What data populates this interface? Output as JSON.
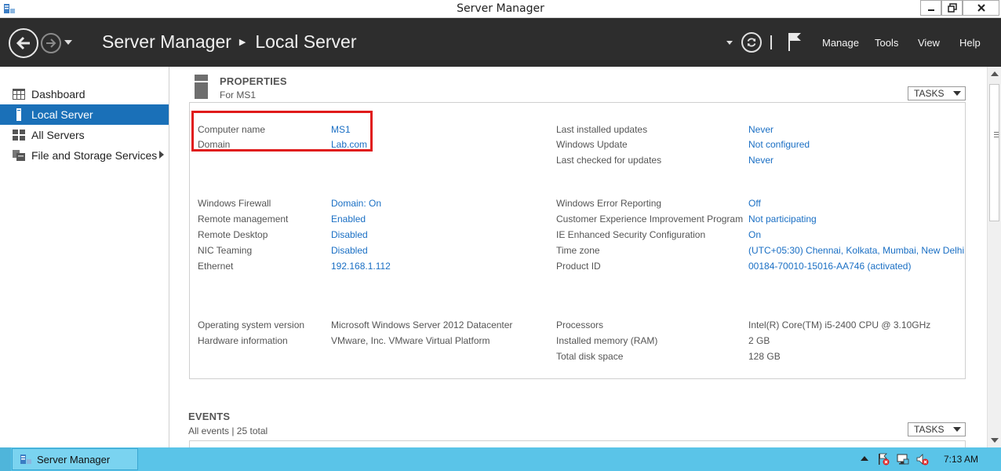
{
  "window": {
    "title": "Server Manager"
  },
  "header": {
    "breadcrumb_root": "Server Manager",
    "breadcrumb_current": "Local Server",
    "menu": [
      "Manage",
      "Tools",
      "View",
      "Help"
    ]
  },
  "sidebar": {
    "items": [
      {
        "label": "Dashboard",
        "icon": "dashboard-grid-icon"
      },
      {
        "label": "Local Server",
        "icon": "server-icon",
        "active": true
      },
      {
        "label": "All Servers",
        "icon": "servers-grid-icon"
      },
      {
        "label": "File and Storage Services",
        "icon": "storage-icon",
        "has_submenu": true
      }
    ]
  },
  "properties": {
    "title": "PROPERTIES",
    "subtitle": "For MS1",
    "tasks_label": "TASKS",
    "left": [
      {
        "label": "Computer name",
        "value": "MS1",
        "link": true
      },
      {
        "label": "Domain",
        "value": "Lab.com",
        "link": true
      },
      {
        "label": "Windows Firewall",
        "value": "Domain: On",
        "link": true
      },
      {
        "label": "Remote management",
        "value": "Enabled",
        "link": true
      },
      {
        "label": "Remote Desktop",
        "value": "Disabled",
        "link": true
      },
      {
        "label": "NIC Teaming",
        "value": "Disabled",
        "link": true
      },
      {
        "label": "Ethernet",
        "value": "192.168.1.112",
        "link": true
      },
      {
        "label": "Operating system version",
        "value": "Microsoft Windows Server 2012 Datacenter",
        "link": false
      },
      {
        "label": "Hardware information",
        "value": "VMware, Inc. VMware Virtual Platform",
        "link": false
      }
    ],
    "right": [
      {
        "label": "Last installed updates",
        "value": "Never",
        "link": true
      },
      {
        "label": "Windows Update",
        "value": "Not configured",
        "link": true
      },
      {
        "label": "Last checked for updates",
        "value": "Never",
        "link": true
      },
      {
        "label": "Windows Error Reporting",
        "value": "Off",
        "link": true
      },
      {
        "label": "Customer Experience Improvement Program",
        "value": "Not participating",
        "link": true
      },
      {
        "label": "IE Enhanced Security Configuration",
        "value": "On",
        "link": true
      },
      {
        "label": "Time zone",
        "value": "(UTC+05:30) Chennai, Kolkata, Mumbai, New Delhi",
        "link": true
      },
      {
        "label": "Product ID",
        "value": "00184-70010-15016-AA746 (activated)",
        "link": true
      },
      {
        "label": "Processors",
        "value": "Intel(R) Core(TM) i5-2400 CPU @ 3.10GHz",
        "link": false
      },
      {
        "label": "Installed memory (RAM)",
        "value": "2 GB",
        "link": false
      },
      {
        "label": "Total disk space",
        "value": "128 GB",
        "link": false
      }
    ]
  },
  "events": {
    "title": "EVENTS",
    "subtitle": "All events | 25 total",
    "tasks_label": "TASKS"
  },
  "taskbar": {
    "app_label": "Server Manager",
    "clock": "7:13 AM"
  },
  "colors": {
    "header_bg": "#2d2d2d",
    "active_nav": "#1a70b8",
    "link": "#1a6fc4",
    "highlight": "#e01b1b",
    "taskbar": "#5ac4e8"
  }
}
